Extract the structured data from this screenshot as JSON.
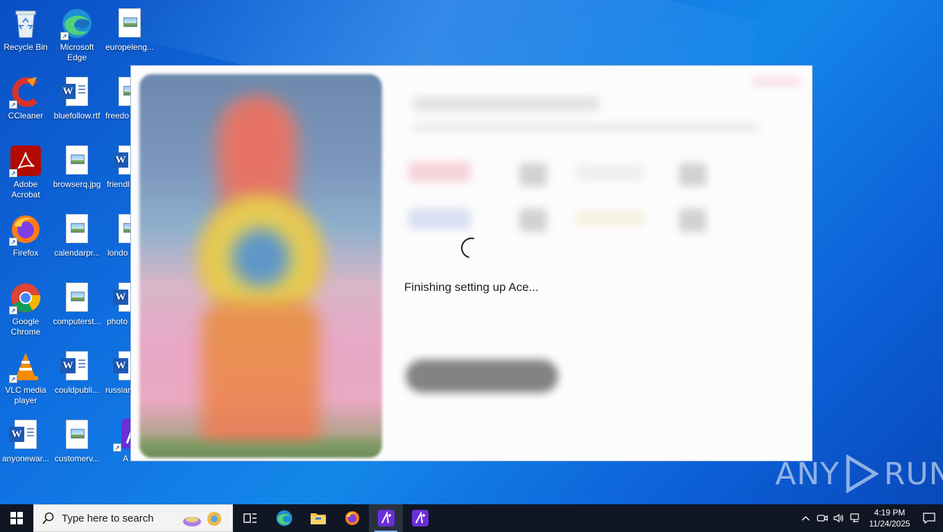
{
  "desktop": {
    "icons": [
      {
        "label": "Recycle Bin"
      },
      {
        "label": "Microsoft Edge"
      },
      {
        "label": "europeleng..."
      },
      {
        "label": "CCleaner"
      },
      {
        "label": "bluefollow.rtf"
      },
      {
        "label": "freedo"
      },
      {
        "label": "Adobe Acrobat"
      },
      {
        "label": "browserq.jpg"
      },
      {
        "label": "friendl"
      },
      {
        "label": "Firefox"
      },
      {
        "label": "calendarpr..."
      },
      {
        "label": "londo"
      },
      {
        "label": "Google Chrome"
      },
      {
        "label": "computerst..."
      },
      {
        "label": "photo"
      },
      {
        "label": "VLC media player"
      },
      {
        "label": "couldpubli..."
      },
      {
        "label": "russian"
      },
      {
        "label": "anyonewar..."
      },
      {
        "label": "customerv..."
      },
      {
        "label": "A"
      }
    ]
  },
  "installer": {
    "status": "Finishing setting up Ace..."
  },
  "watermark": {
    "left": "ANY",
    "right": "RUN"
  },
  "taskbar": {
    "search_placeholder": "Type here to search",
    "clock_time": "4:19 PM",
    "clock_date": "11/24/2025"
  }
}
